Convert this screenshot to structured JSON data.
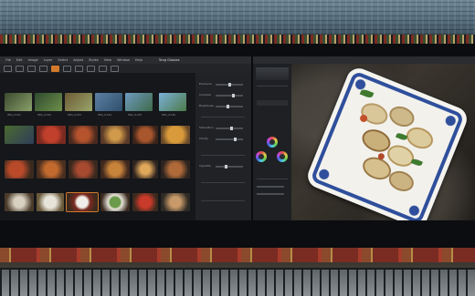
{
  "app": {
    "title": "Tang Glasses",
    "menu": [
      "File",
      "Edit",
      "Image",
      "Layer",
      "Select",
      "Adjust",
      "Styles",
      "View",
      "Window",
      "Help"
    ]
  },
  "browser": {
    "captions": [
      "IMG_0141",
      "IMG_0142",
      "IMG_0143",
      "IMG_0144",
      "IMG_0145",
      "IMG_0146"
    ]
  },
  "adjustments": {
    "sections": [
      "Exposure",
      "Contrast",
      "Brightness",
      "Saturation",
      "Clarity",
      "Vignette"
    ]
  },
  "colors": {
    "accent": "#d27a2c",
    "plate_blue": "#2f4f9c",
    "ui_dark": "#191b1e"
  }
}
